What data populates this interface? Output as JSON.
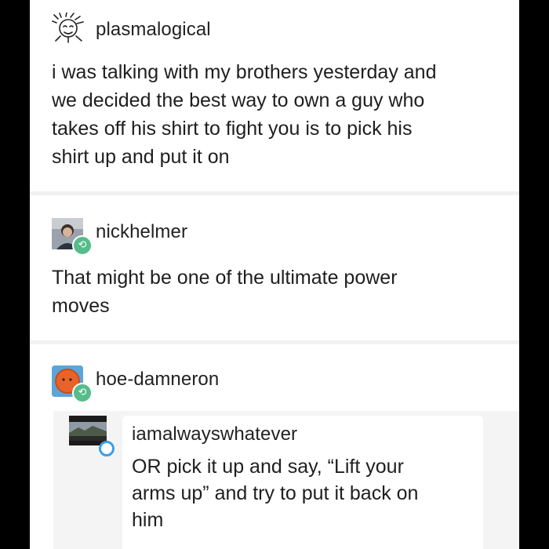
{
  "posts": [
    {
      "username": "plasmalogical",
      "avatar": "sketch-face-avatar",
      "lines": [
        "i was talking with my brothers yesterday and",
        "we decided the best way to own a guy who",
        "takes off his shirt to fight you is to pick his",
        "shirt up and put it on"
      ]
    },
    {
      "username": "nickhelmer",
      "avatar": "portrait-photo-avatar",
      "badge_icon": "reblog-icon",
      "lines": [
        "That might be one of the ultimate power",
        "moves"
      ]
    },
    {
      "username": "hoe-damneron",
      "avatar": "orange-circle-avatar",
      "badge_icon": "reblog-icon",
      "quoted": {
        "username": "iamalwayswhatever",
        "avatar": "landscape-photo-avatar",
        "badge_icon": "follow-dot-icon",
        "lines": [
          "OR pick it up and say, “Lift your",
          "arms up” and try to put it back on",
          "him"
        ]
      }
    }
  ],
  "colors": {
    "background": "#000000",
    "card": "#ffffff",
    "divider": "#f1f1f1",
    "reblog_badge": "#56bc8a",
    "follow_dot": "#3b9ee8"
  }
}
